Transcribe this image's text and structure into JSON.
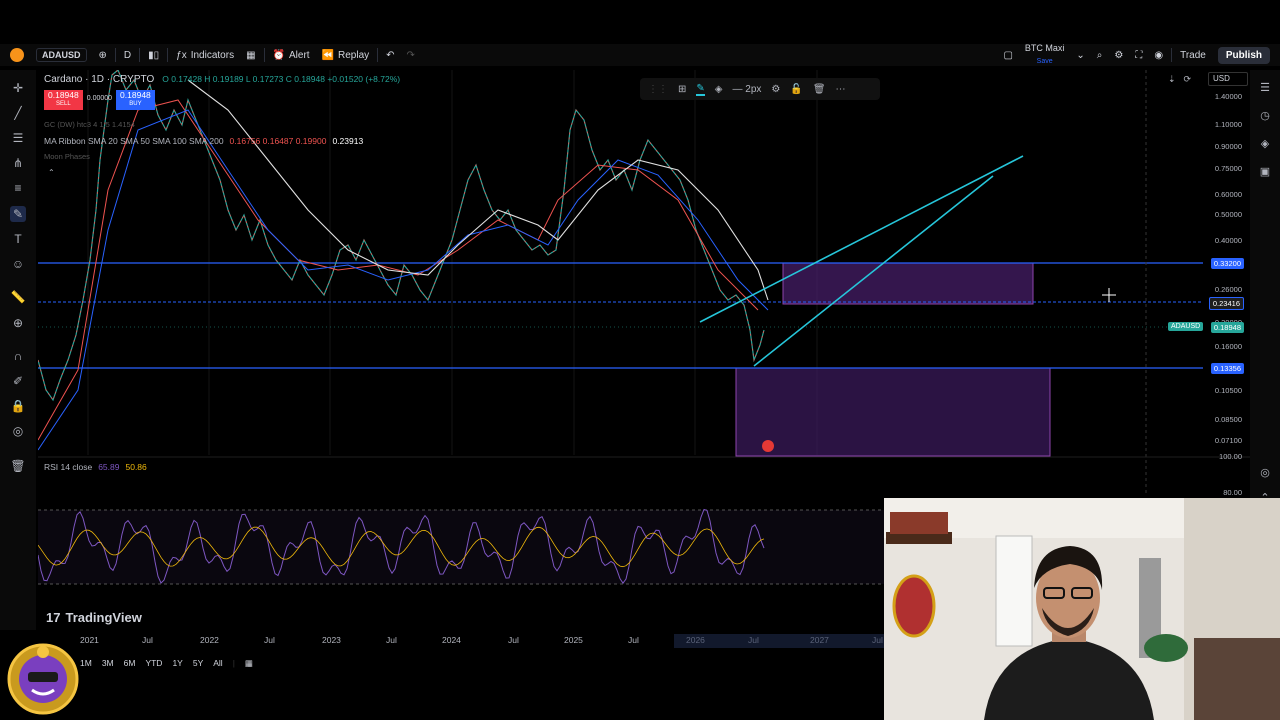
{
  "topbar": {
    "symbol": "ADAUSD",
    "interval": "D",
    "indicators_label": "Indicators",
    "alert_label": "Alert",
    "replay_label": "Replay",
    "layout_name": "BTC Maxi",
    "layout_sub": "Save",
    "trade_label": "Trade",
    "publish_label": "Publish"
  },
  "chart_header": {
    "title": "Cardano · 1D · CRYPTO",
    "ohlc": "O 0.17428  H 0.19189  L 0.17273  C 0.18948  +0.01520 (+8.72%)",
    "sell_price": "0.18948",
    "sell_label": "SELL",
    "spread": "0.00000",
    "buy_price": "0.18948",
    "buy_label": "BUY",
    "gc_label": "GC (DW) htc3  4  1.5  1.4154",
    "ma_label": "MA Ribbon  SMA 20  SMA 50  SMA 100  SMA 200",
    "ma_values": "0.16756  0.16487  0.19900",
    "ma_last": "0.23913",
    "moon_label": "Moon Phases"
  },
  "float_toolbar": {
    "width_label": "2px"
  },
  "price_axis": {
    "currency": "USD",
    "ticks": [
      "1.40000",
      "1.10000",
      "0.90000",
      "0.75000",
      "0.60000",
      "0.50000",
      "0.40000",
      "0.26000",
      "0.20000",
      "0.16000",
      "0.10500",
      "0.08500",
      "0.07100"
    ],
    "tag_upper": "0.33200",
    "tag_mid": "0.23416",
    "tag_current_symbol": "ADAUSD",
    "tag_current": "0.18948",
    "tag_lower": "0.13356",
    "rsi_top": "100.00",
    "rsi_mid": "80.00"
  },
  "rsi": {
    "label": "RSI 14 close",
    "value1": "65.89",
    "value2": "50.86"
  },
  "time_axis": {
    "labels": [
      "2021",
      "Jul",
      "2022",
      "Jul",
      "2023",
      "Jul",
      "2024",
      "Jul",
      "2025",
      "Jul",
      "2026",
      "Jul",
      "2027",
      "Jul"
    ]
  },
  "range_bar": {
    "items": [
      "1M",
      "3M",
      "6M",
      "YTD",
      "1Y",
      "5Y",
      "All"
    ]
  },
  "branding": {
    "logo_text": "TradingView"
  },
  "colors": {
    "accent": "#2962ff",
    "hline": "#2962ff",
    "zone": "#4a1f6e",
    "trendline": "#26c6da",
    "rsi_line": "#7e57c2",
    "sell": "#f23645",
    "buy": "#2962ff"
  }
}
